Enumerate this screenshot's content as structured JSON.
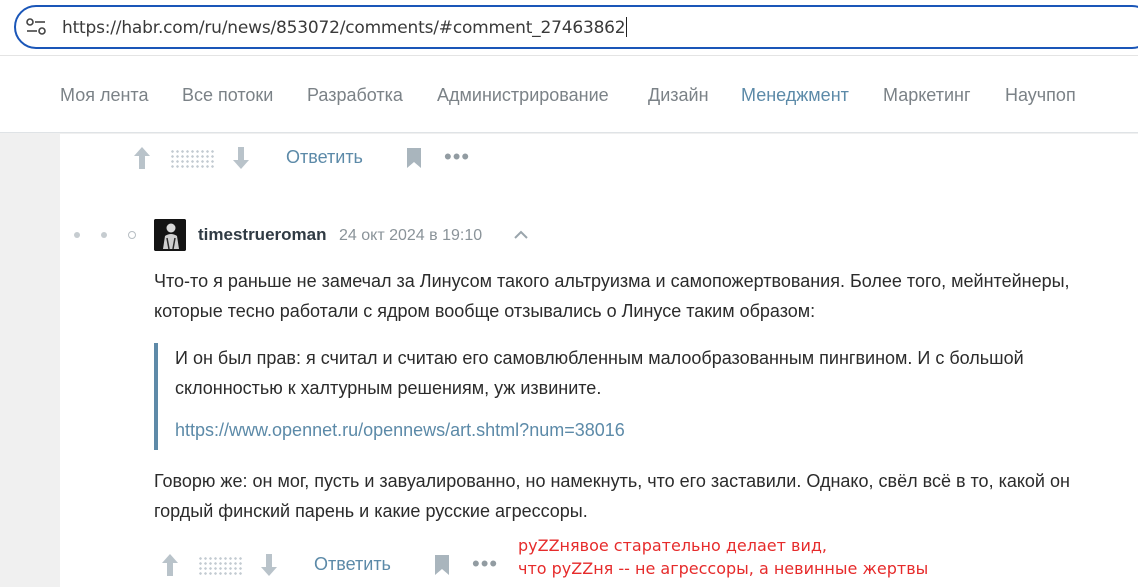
{
  "browser": {
    "url": "https://habr.com/ru/news/853072/comments/#comment_27463862"
  },
  "nav": {
    "items": [
      {
        "label": "Моя лента",
        "active": false
      },
      {
        "label": "Все потоки",
        "active": false
      },
      {
        "label": "Разработка",
        "active": false
      },
      {
        "label": "Администрирование",
        "active": false
      },
      {
        "label": "Дизайн",
        "active": false
      },
      {
        "label": "Менеджмент",
        "active": true
      },
      {
        "label": "Маркетинг",
        "active": false
      },
      {
        "label": "Научпоп",
        "active": false
      }
    ]
  },
  "prev_comment": {
    "reply_label": "Ответить",
    "more_label": "•••"
  },
  "comment": {
    "author": "timestrueroman",
    "date": "24 окт 2024 в 19:10",
    "paragraph1": "Что-то я раньше не замечал за Линусом такого альтруизма и самопожертвования. Более того, мейнтейнеры, которые тесно работали с ядром вообще отзывались о Линусе таким образом:",
    "quote": {
      "text": "И он был прав: я считал и считаю его самовлюбленным малообразованным пингвином. И с большой склонностью к халтурным решениям, уж извините.",
      "link": "https://www.opennet.ru/opennews/art.shtml?num=38016"
    },
    "paragraph2": "Говорю же: он мог, пусть и завуалированно, но намекнуть, что его заставили. Однако, свёл всё в то, какой он гордый финский парень и какие русские агрессоры.",
    "reply_label": "Ответить",
    "more_label": "•••"
  },
  "annotation": {
    "line1": "руZZнявое старательно делает вид,",
    "line2": "что руZZня -- не агрессоры, а невинные жертвы"
  },
  "colors": {
    "accent": "#5c8aa8",
    "url_border": "#1a56b8",
    "annotation": "#e62b2b"
  }
}
